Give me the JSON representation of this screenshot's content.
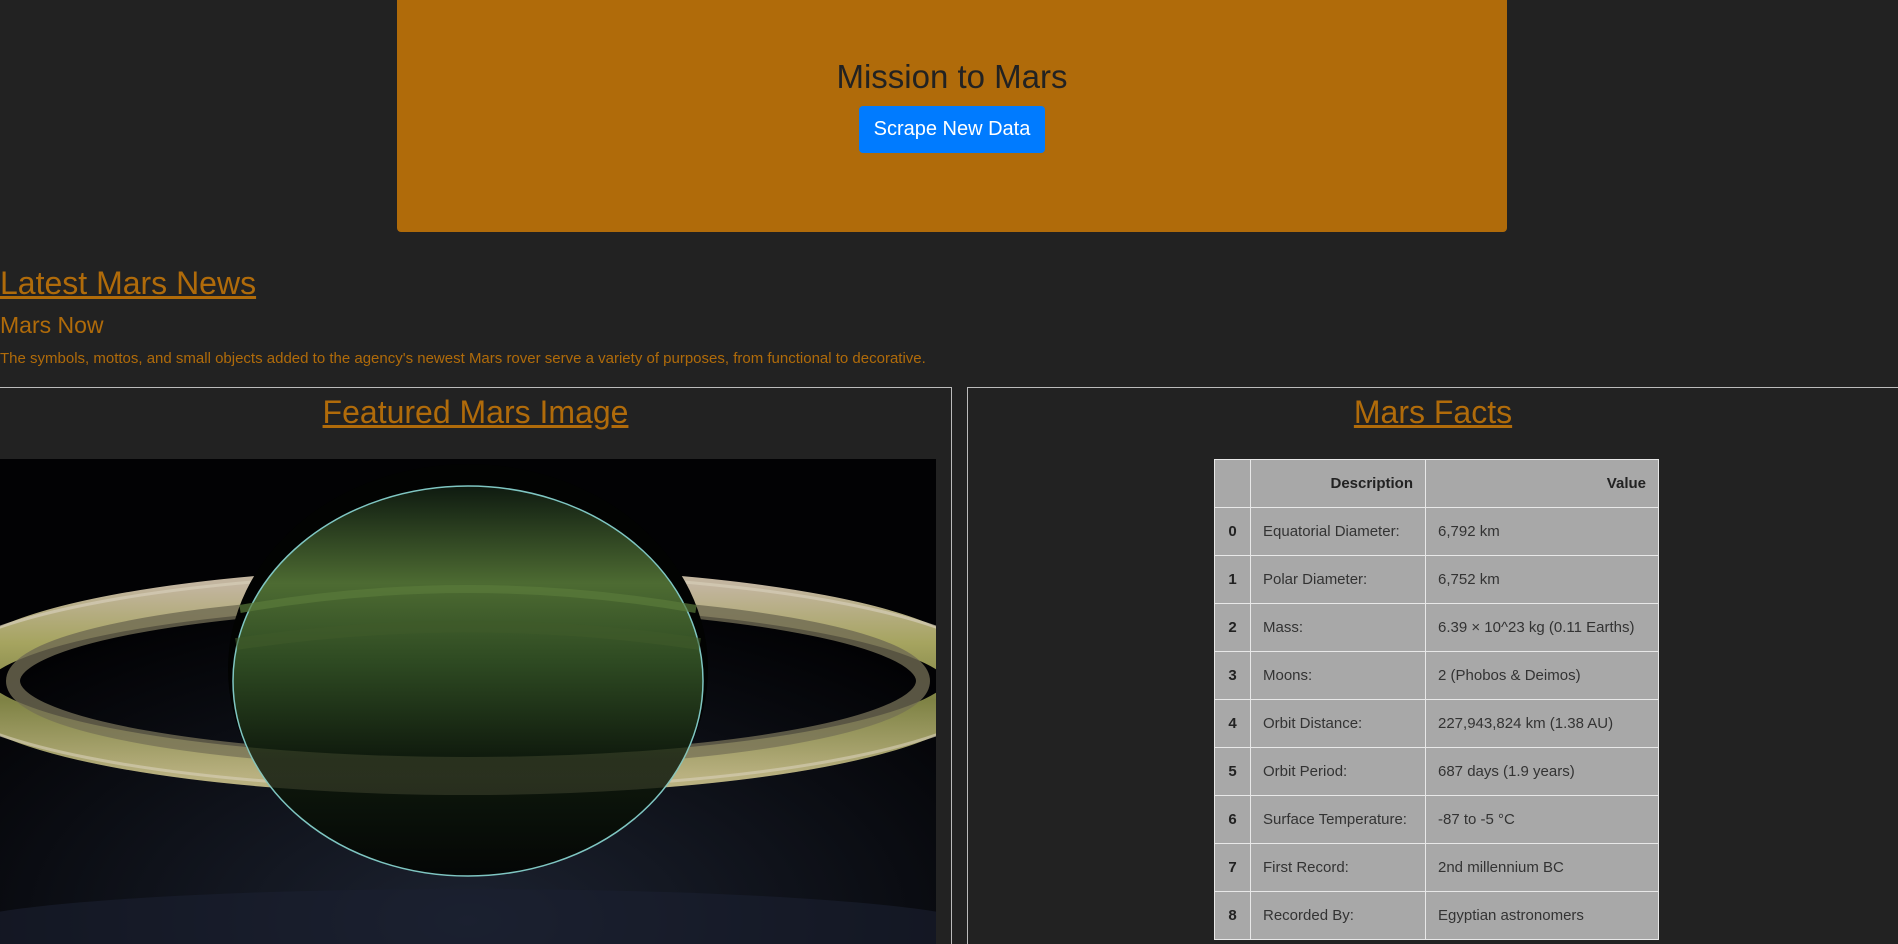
{
  "header": {
    "title": "Mission to Mars",
    "button_label": "Scrape New Data"
  },
  "news": {
    "section_title": "Latest Mars News",
    "headline": "Mars Now",
    "teaser": "The symbols, mottos, and small objects added to the agency's newest Mars rover serve a variety of purposes, from functional to decorative."
  },
  "featured": {
    "section_title": "Featured Mars Image"
  },
  "facts": {
    "section_title": "Mars Facts",
    "columns": [
      "",
      "Description",
      "Value"
    ],
    "rows": [
      {
        "index": "0",
        "description": "Equatorial Diameter:",
        "value": "6,792 km"
      },
      {
        "index": "1",
        "description": "Polar Diameter:",
        "value": "6,752 km"
      },
      {
        "index": "2",
        "description": "Mass:",
        "value": "6.39 × 10^23 kg (0.11 Earths)"
      },
      {
        "index": "3",
        "description": "Moons:",
        "value": "2 (Phobos & Deimos)"
      },
      {
        "index": "4",
        "description": "Orbit Distance:",
        "value": "227,943,824 km (1.38 AU)"
      },
      {
        "index": "5",
        "description": "Orbit Period:",
        "value": "687 days (1.9 years)"
      },
      {
        "index": "6",
        "description": "Surface Temperature:",
        "value": "-87 to -5 °C"
      },
      {
        "index": "7",
        "description": "First Record:",
        "value": "2nd millennium BC"
      },
      {
        "index": "8",
        "description": "Recorded By:",
        "value": "Egyptian astronomers"
      }
    ]
  },
  "colors": {
    "background": "#222222",
    "accent": "#b06b0a",
    "button": "#007bff",
    "table_bg": "#a8a8a8"
  }
}
